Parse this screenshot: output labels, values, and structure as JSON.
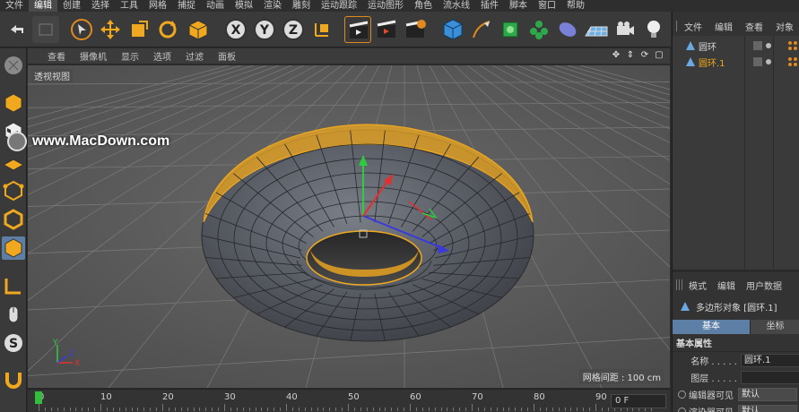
{
  "menu": [
    "文件",
    "编辑",
    "创建",
    "选择",
    "工具",
    "网格",
    "捕捉",
    "动画",
    "模拟",
    "渲染",
    "雕刻",
    "运动跟踪",
    "运动图形",
    "角色",
    "流水线",
    "插件",
    "脚本",
    "窗口",
    "帮助"
  ],
  "menu_active_index": 1,
  "toolbar": {
    "icons": [
      "undo-icon",
      "redo-icon",
      "select-cursor-icon",
      "move-icon",
      "scale-icon",
      "rotate-icon",
      "last-tool-icon",
      "x-axis-lock-icon",
      "y-axis-lock-icon",
      "z-axis-lock-icon",
      "coordinate-system-icon",
      "render-view-icon",
      "render-picture-viewer-icon",
      "render-settings-icon",
      "cube-icon",
      "pen-spline-icon",
      "subdivision-icon",
      "mograph-cloner-icon",
      "deformer-icon",
      "floor-icon",
      "camera-icon",
      "light-icon"
    ],
    "x_label": "X",
    "y_label": "Y",
    "z_label": "Z"
  },
  "viewport": {
    "menu": [
      "查看",
      "摄像机",
      "显示",
      "选项",
      "过滤",
      "面板"
    ],
    "label": "透视视图",
    "grid_info": "网格间距 : 100 cm",
    "watermark": "www.MacDown.com",
    "axis_y": "Y",
    "axis_x": "X",
    "axis_z": "Z"
  },
  "timeline": {
    "ticks": [
      "0",
      "10",
      "20",
      "30",
      "40",
      "50",
      "60",
      "70",
      "80",
      "90"
    ],
    "frame": "0 F",
    "current_frame": 0
  },
  "object_manager": {
    "menu": [
      "文件",
      "编辑",
      "查看",
      "对象"
    ],
    "objects": [
      {
        "name": "圆环",
        "selected": false
      },
      {
        "name": "圆环.1",
        "selected": true
      }
    ]
  },
  "attribute_manager": {
    "menu": [
      "模式",
      "编辑",
      "用户数据"
    ],
    "title": "多边形对象 [圆环.1]",
    "tabs": [
      "基本",
      "坐标"
    ],
    "section": "基本属性",
    "fields": {
      "name_label": "名称 . . . . .",
      "name_value": "圆环.1",
      "layer_label": "图层 . . . . .",
      "layer_value": "",
      "editor_visible_label": "编辑器可见",
      "editor_visible_value": "默认",
      "render_visible_label": "渲染器可见",
      "render_visible_value": "默认"
    }
  },
  "colors": {
    "accent_blue": "#5d7fa5",
    "selection_orange": "#f0a81e",
    "playhead_green": "#2fbf3a",
    "viewport_bg": "#555555"
  }
}
